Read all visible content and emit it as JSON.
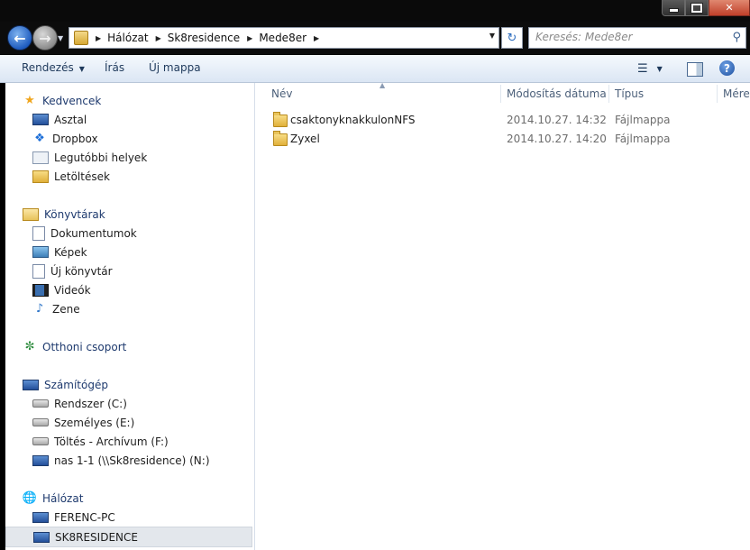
{
  "window": {
    "min_label": "",
    "max_label": "",
    "close_label": "✕"
  },
  "address": {
    "crumbs": [
      "Hálózat",
      "Sk8residence",
      "Mede8er"
    ]
  },
  "search": {
    "placeholder": "Keresés: Mede8er"
  },
  "toolbar": {
    "organize_label": "Rendezés",
    "burn_label": "Írás",
    "new_folder_label": "Új mappa",
    "help_label": "?"
  },
  "nav": {
    "favorites": {
      "label": "Kedvencek",
      "items": [
        {
          "label": "Asztal",
          "icon": "desktop-icon"
        },
        {
          "label": "Dropbox",
          "icon": "dropbox-icon"
        },
        {
          "label": "Legutóbbi helyek",
          "icon": "recent-places-icon"
        },
        {
          "label": "Letöltések",
          "icon": "downloads-icon"
        }
      ]
    },
    "libraries": {
      "label": "Könyvtárak",
      "items": [
        {
          "label": "Dokumentumok",
          "icon": "documents-icon"
        },
        {
          "label": "Képek",
          "icon": "pictures-icon"
        },
        {
          "label": "Új könyvtár",
          "icon": "library-icon"
        },
        {
          "label": "Videók",
          "icon": "videos-icon"
        },
        {
          "label": "Zene",
          "icon": "music-icon"
        }
      ]
    },
    "homegroup": {
      "label": "Otthoni csoport"
    },
    "computer": {
      "label": "Számítógép",
      "items": [
        {
          "label": "Rendszer (C:)",
          "icon": "system-drive-icon"
        },
        {
          "label": "Személyes (E:)",
          "icon": "drive-icon"
        },
        {
          "label": "Töltés - Archívum (F:)",
          "icon": "drive-icon"
        },
        {
          "label": "nas 1-1 (\\\\Sk8residence) (N:)",
          "icon": "network-drive-icon"
        }
      ]
    },
    "network": {
      "label": "Hálózat",
      "items": [
        {
          "label": "FERENC-PC",
          "icon": "computer-icon"
        },
        {
          "label": "SK8RESIDENCE",
          "icon": "computer-icon",
          "selected": true
        }
      ]
    }
  },
  "filelist": {
    "columns": [
      "Név",
      "Módosítás dátuma",
      "Típus",
      "Méret"
    ],
    "rows": [
      {
        "name": "csaktonyknakkulonNFS",
        "date": "2014.10.27. 14:32",
        "type": "Fájlmappa"
      },
      {
        "name": "Zyxel",
        "date": "2014.10.27. 14:20",
        "type": "Fájlmappa"
      }
    ]
  }
}
